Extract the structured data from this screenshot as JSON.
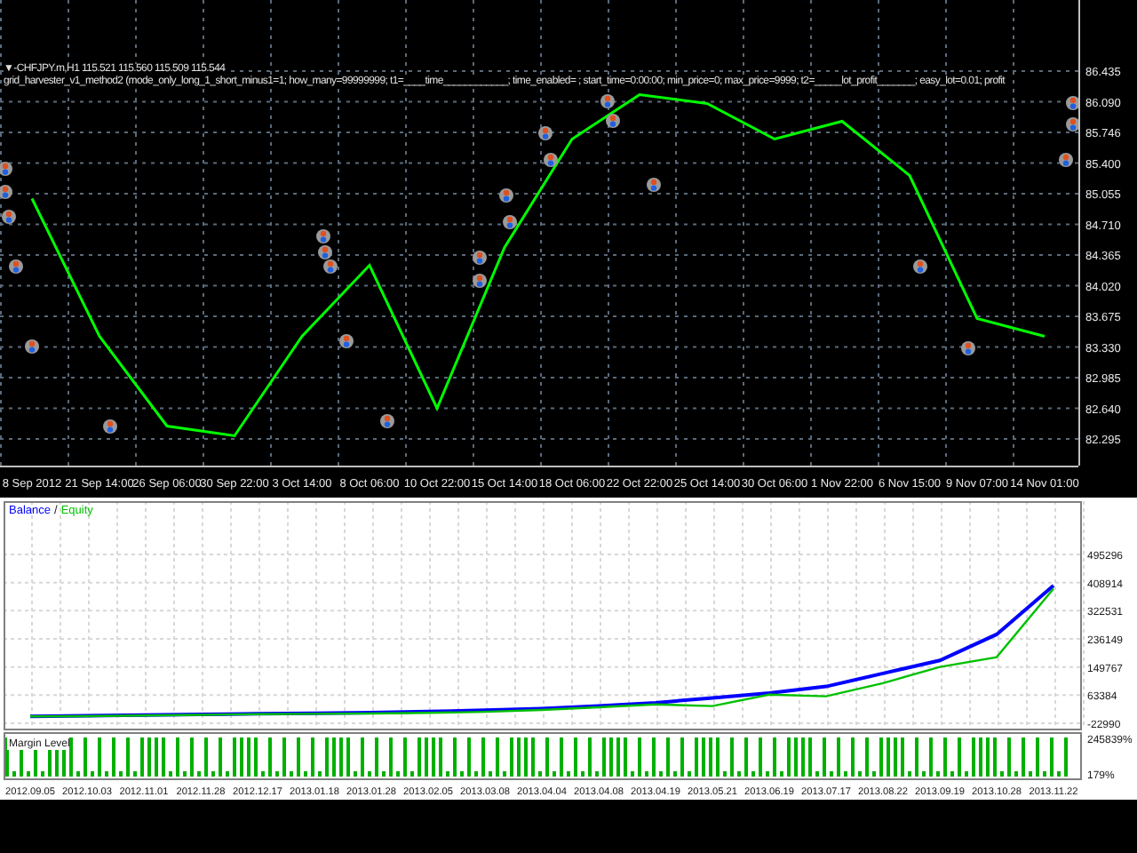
{
  "header": {
    "symbol_line": "▼-CHFJPY.m,H1  115.521 115.560 115.509 115.544",
    "expert_line": "grid_harvester_v1_method2 (mode_only_long_1_short_minus1=1; how_many=99999999; t1=____time____________; time_enabled=     ; start_time=0:00:00; min_price=0; max_price=9999; t2=_____lot_profit_______; easy_lot=0.01; profit"
  },
  "price_chart": {
    "chart_data": {
      "type": "line",
      "categories": [
        "8 Sep 2012",
        "21 Sep 14:00",
        "26 Sep 06:00",
        "30 Sep 22:00",
        "3 Oct 14:00",
        "8 Oct 06:00",
        "10 Oct 22:00",
        "15 Oct 14:00",
        "18 Oct 06:00",
        "22 Oct 22:00",
        "25 Oct 14:00",
        "30 Oct 06:00",
        "1 Nov 22:00",
        "6 Nov 15:00",
        "9 Nov 07:00",
        "14 Nov 01:00"
      ],
      "series": [
        {
          "color": "#00ff00",
          "values": [
            85.0,
            83.45,
            82.44,
            82.33,
            83.45,
            84.25,
            82.64,
            84.45,
            85.67,
            86.17,
            86.07,
            85.67,
            85.87,
            85.26,
            83.65,
            83.45
          ]
        }
      ],
      "ylim": [
        81.995,
        87.235
      ],
      "grid": true,
      "yticks": [
        {
          "value": 86.435,
          "label": "86.435"
        },
        {
          "value": 86.09,
          "label": "86.090"
        },
        {
          "value": 85.746,
          "label": "85.746"
        },
        {
          "value": 85.4,
          "label": "85.400"
        },
        {
          "value": 85.055,
          "label": "85.055"
        },
        {
          "value": 84.71,
          "label": "84.710"
        },
        {
          "value": 84.365,
          "label": "84.365"
        },
        {
          "value": 84.02,
          "label": "84.020"
        },
        {
          "value": 83.675,
          "label": "83.675"
        },
        {
          "value": 83.33,
          "label": "83.330"
        },
        {
          "value": 82.985,
          "label": "82.985"
        },
        {
          "value": 82.64,
          "label": "82.640"
        },
        {
          "value": 82.295,
          "label": "82.295"
        }
      ]
    }
  },
  "balance_chart": {
    "legend_separator": "/",
    "chart_data": {
      "type": "line",
      "categories": [
        "2012.09.05",
        "2012.10.03",
        "2012.11.01",
        "2012.11.28",
        "2012.12.17",
        "2013.01.18",
        "2013.01.28",
        "2013.02.05",
        "2013.03.08",
        "2013.04.04",
        "2013.04.08",
        "2013.04.19",
        "2013.05.21",
        "2013.06.19",
        "2013.07.17",
        "2013.08.22",
        "2013.09.19",
        "2013.10.28",
        "2013.11.22"
      ],
      "series": [
        {
          "name": "Balance",
          "color": "#0000ff",
          "values": [
            -2000,
            0,
            2000,
            4000,
            6000,
            8000,
            10000,
            13000,
            17000,
            22000,
            30000,
            40000,
            55000,
            70000,
            90000,
            130000,
            170000,
            250000,
            400000
          ]
        },
        {
          "name": "Equity",
          "color": "#00c000",
          "values": [
            -2000,
            -1000,
            1000,
            3000,
            5000,
            6000,
            7000,
            9000,
            12000,
            18000,
            26000,
            35000,
            30000,
            65000,
            60000,
            100000,
            150000,
            180000,
            390000
          ]
        }
      ],
      "ylim": [
        -39353,
        658964
      ],
      "grid": true,
      "yticks": [
        {
          "value": 495296,
          "label": "495296"
        },
        {
          "value": 408914,
          "label": "408914"
        },
        {
          "value": 322531,
          "label": "322531"
        },
        {
          "value": 236149,
          "label": "236149"
        },
        {
          "value": 149767,
          "label": "149767"
        },
        {
          "value": 63384,
          "label": "63384"
        },
        {
          "value": -22990,
          "label": "-22990"
        }
      ]
    }
  },
  "margin_level": {
    "title": "Margin Level",
    "top_label": "245839%",
    "bottom_label": "179%"
  }
}
